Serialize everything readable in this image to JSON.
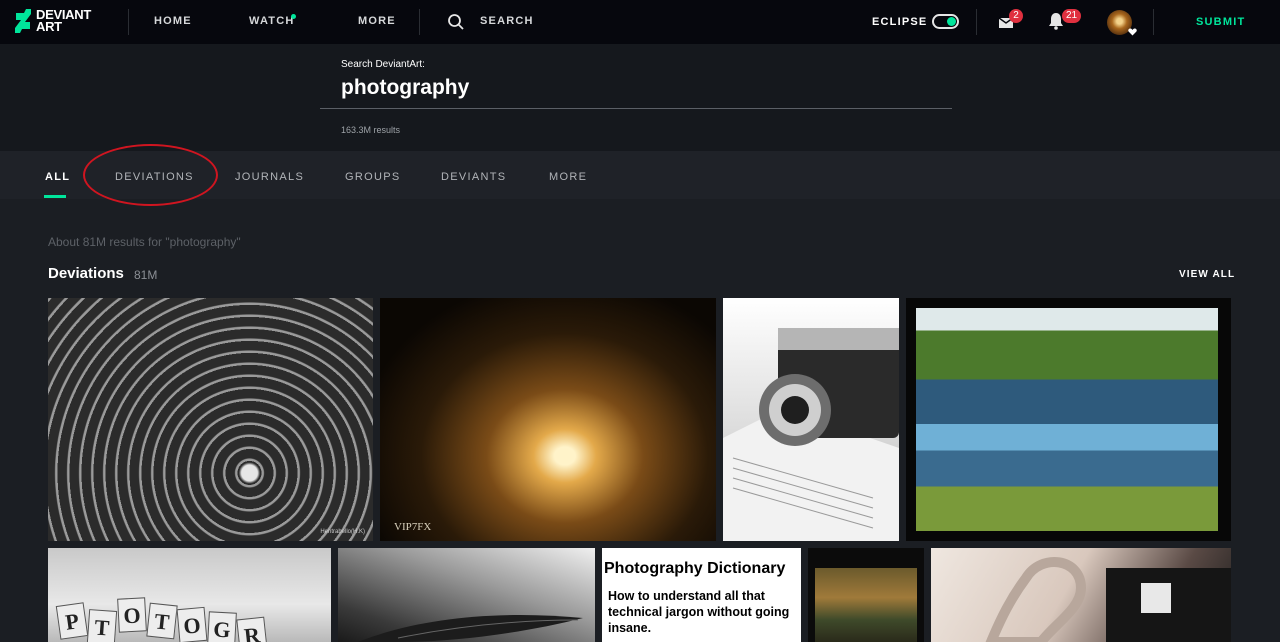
{
  "header": {
    "logo_line1": "DEVIANT",
    "logo_line2": "ART",
    "nav": {
      "home": "HOME",
      "watch": "WATCH",
      "more": "MORE",
      "search": "SEARCH"
    },
    "eclipse_label": "ECLIPSE",
    "messages_badge": "2",
    "notifications_badge": "21",
    "submit": "SUBMIT",
    "icons": [
      "deviantart-logo-icon",
      "search-icon",
      "messages-icon",
      "bell-icon",
      "avatar"
    ]
  },
  "search": {
    "label": "Search DeviantArt:",
    "query": "photography",
    "results": "163.3M results"
  },
  "tabs": [
    "ALL",
    "DEVIATIONS",
    "JOURNALS",
    "GROUPS",
    "DEVIANTS",
    "MORE"
  ],
  "results": {
    "about": "About 81M results for \"photography\"",
    "section_title": "Deviations",
    "section_count": "81M",
    "view_all": "VIEW ALL"
  },
  "thumbnails": {
    "t1_watermark": "Hentrabello(H.K)",
    "t2_watermark": "VIP7FX",
    "t5_tiles": [
      "P",
      "T",
      "O",
      "T",
      "O",
      "G",
      "R"
    ],
    "t7_title": "Photography Dictionary",
    "t7_body": "How to understand all that technical jargon without going insane."
  },
  "colors": {
    "accent": "#00e59b",
    "badge": "#e0303f",
    "annotation": "#d01520"
  }
}
